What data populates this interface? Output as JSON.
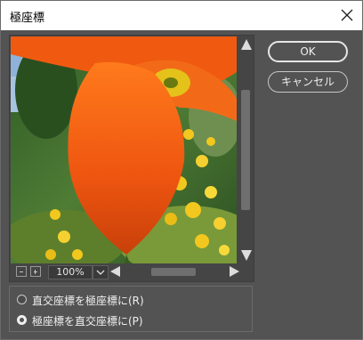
{
  "window": {
    "title": "極座標",
    "close_icon": "close-icon"
  },
  "preview": {
    "zoom_value": "100%",
    "zoom_out_icon": "zoom-out-icon",
    "zoom_in_icon": "zoom-in-icon"
  },
  "buttons": {
    "ok": "OK",
    "cancel": "キャンセル"
  },
  "options": [
    {
      "label": "直交座標を極座標に(R)",
      "selected": false
    },
    {
      "label": "極座標を直交座標に(P)",
      "selected": true
    }
  ],
  "colors": {
    "dialog_bg": "#535353",
    "petal": "#f05a10",
    "foliage": "#3e6b2e",
    "flower_yellow": "#f2c81e"
  }
}
